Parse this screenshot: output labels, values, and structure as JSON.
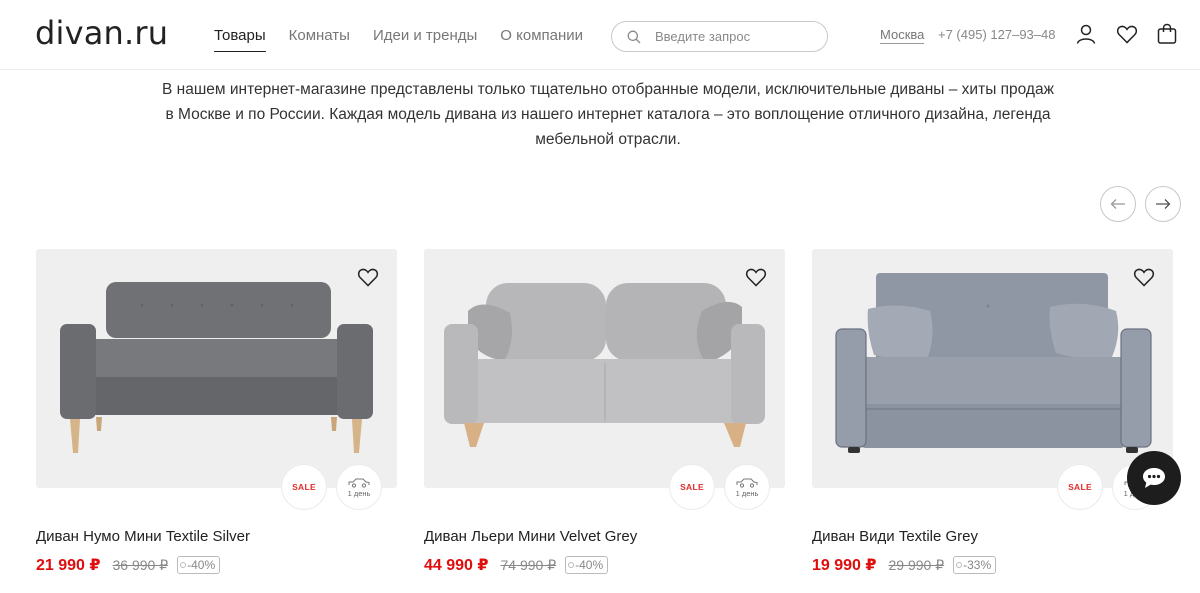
{
  "header": {
    "logo": "divan.ru",
    "nav": [
      "Товары",
      "Комнаты",
      "Идеи и тренды",
      "О компании"
    ],
    "search_placeholder": "Введите запрос",
    "city": "Москва",
    "phone": "+7 (495) 127–93–48",
    "icons": [
      "user-icon",
      "heart-icon",
      "bag-icon"
    ]
  },
  "intro": {
    "line1": "В нашем интернет-магазине представлены только тщательно отобранные модели, исключительные диваны – хиты продаж",
    "line2": "в Москве и по России. Каждая модель дивана из нашего интернет каталога – это воплощение отличного дизайна, легенда",
    "line3": "мебельной отрасли."
  },
  "carousel": {
    "prev_icon": "arrow-left-icon",
    "next_icon": "arrow-right-icon"
  },
  "products": [
    {
      "title": "Диван Нумо Мини Textile Silver",
      "price": "21 990 ₽",
      "old_price": "36 990 ₽",
      "discount": "-40%",
      "sale_badge": "SALE",
      "delivery_badge": "1 день"
    },
    {
      "title": "Диван Льери Мини Velvet Grey",
      "price": "44 990 ₽",
      "old_price": "74 990 ₽",
      "discount": "-40%",
      "sale_badge": "SALE",
      "delivery_badge": "1 день"
    },
    {
      "title": "Диван Види Textile Grey",
      "price": "19 990 ₽",
      "old_price": "29 990 ₽",
      "discount": "-33%",
      "sale_badge": "SALE",
      "delivery_badge": "1 день"
    }
  ],
  "colors": {
    "accent_price": "#e00d0d",
    "sale_text": "#e22a2a",
    "chat_bg": "#1d1d1d",
    "card_bg": "#efefef"
  }
}
